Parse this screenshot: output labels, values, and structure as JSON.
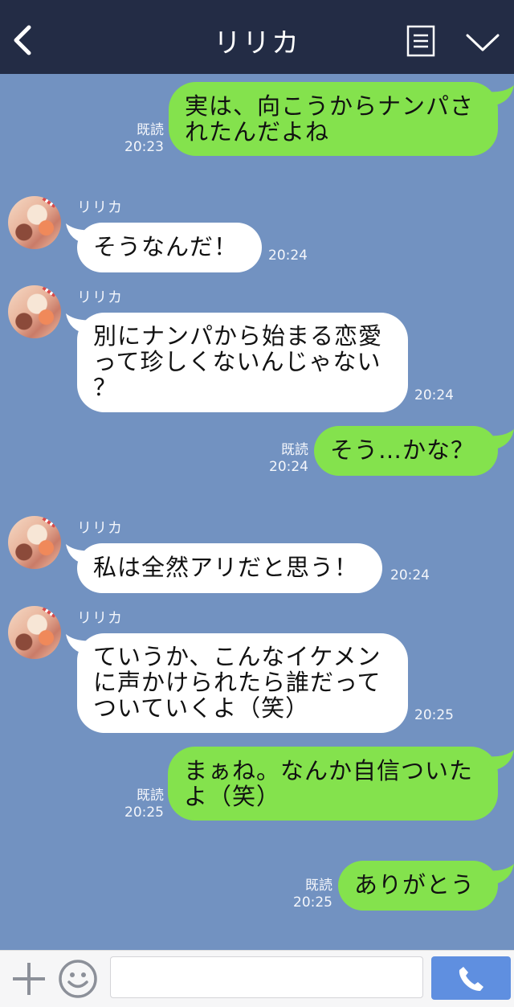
{
  "header": {
    "title": "リリカ",
    "back_icon": "chevron-left-icon",
    "menu_icon": "document-menu-icon",
    "collapse_icon": "chevron-down-icon"
  },
  "messages": [
    {
      "side": "right",
      "text": "実は、向こうからナンパさ\nれたんだよね",
      "read": "既読",
      "time": "20:23"
    },
    {
      "side": "left",
      "sender": "リリカ",
      "text": "そうなんだ！",
      "time": "20:24"
    },
    {
      "side": "left",
      "sender": "リリカ",
      "text": "別にナンパから始まる恋愛\nって珍しくないんじゃない\n？",
      "time": "20:24"
    },
    {
      "side": "right",
      "text": "そう…かな？",
      "read": "既読",
      "time": "20:24"
    },
    {
      "side": "left",
      "sender": "リリカ",
      "text": "私は全然アリだと思う！",
      "time": "20:24"
    },
    {
      "side": "left",
      "sender": "リリカ",
      "text": "ていうか、こんなイケメン\nに声かけられたら誰だって\nついていくよ（笑）",
      "time": "20:25"
    },
    {
      "side": "right",
      "text": "まぁね。なんか自信ついた\nよ（笑）",
      "read": "既読",
      "time": "20:25"
    },
    {
      "side": "right",
      "text": "ありがとう",
      "read": "既読",
      "time": "20:25"
    }
  ],
  "footer": {
    "input_value": "",
    "plus_icon": "plus-icon",
    "emoji_icon": "smiley-icon",
    "call_icon": "phone-icon"
  },
  "colors": {
    "header_bg": "#232c45",
    "chat_bg": "#7292c1",
    "sent_bubble": "#84e24d",
    "received_bubble": "#ffffff",
    "call_button": "#5f8fe0"
  }
}
